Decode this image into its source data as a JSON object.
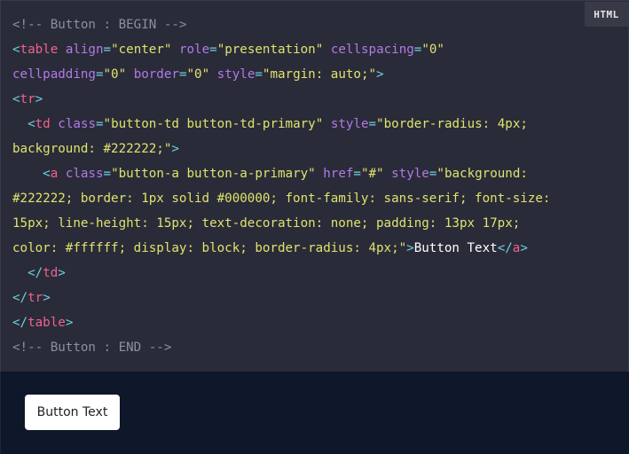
{
  "code_block": {
    "language_label": "HTML",
    "lines": [
      [
        {
          "cls": "c",
          "text": "<!-- Button : BEGIN -->"
        }
      ],
      [
        {
          "cls": "p",
          "text": "<"
        },
        {
          "cls": "t",
          "text": "table"
        },
        {
          "cls": "x",
          "text": " "
        },
        {
          "cls": "a",
          "text": "align"
        },
        {
          "cls": "p",
          "text": "="
        },
        {
          "cls": "s",
          "text": "\"center\""
        },
        {
          "cls": "x",
          "text": " "
        },
        {
          "cls": "a",
          "text": "role"
        },
        {
          "cls": "p",
          "text": "="
        },
        {
          "cls": "s",
          "text": "\"presentation\""
        },
        {
          "cls": "x",
          "text": " "
        },
        {
          "cls": "a",
          "text": "cellspacing"
        },
        {
          "cls": "p",
          "text": "="
        },
        {
          "cls": "s",
          "text": "\"0\""
        }
      ],
      [
        {
          "cls": "a",
          "text": "cellpadding"
        },
        {
          "cls": "p",
          "text": "="
        },
        {
          "cls": "s",
          "text": "\"0\""
        },
        {
          "cls": "x",
          "text": " "
        },
        {
          "cls": "a",
          "text": "border"
        },
        {
          "cls": "p",
          "text": "="
        },
        {
          "cls": "s",
          "text": "\"0\""
        },
        {
          "cls": "x",
          "text": " "
        },
        {
          "cls": "a",
          "text": "style"
        },
        {
          "cls": "p",
          "text": "="
        },
        {
          "cls": "s",
          "text": "\"margin: auto;\""
        },
        {
          "cls": "p",
          "text": ">"
        }
      ],
      [
        {
          "cls": "p",
          "text": "<"
        },
        {
          "cls": "t",
          "text": "tr"
        },
        {
          "cls": "p",
          "text": ">"
        }
      ],
      [
        {
          "cls": "x",
          "text": "  "
        },
        {
          "cls": "p",
          "text": "<"
        },
        {
          "cls": "t",
          "text": "td"
        },
        {
          "cls": "x",
          "text": " "
        },
        {
          "cls": "a",
          "text": "class"
        },
        {
          "cls": "p",
          "text": "="
        },
        {
          "cls": "s",
          "text": "\"button-td button-td-primary\""
        },
        {
          "cls": "x",
          "text": " "
        },
        {
          "cls": "a",
          "text": "style"
        },
        {
          "cls": "p",
          "text": "="
        },
        {
          "cls": "s",
          "text": "\"border-radius: 4px;"
        }
      ],
      [
        {
          "cls": "s",
          "text": "background: #222222;\""
        },
        {
          "cls": "p",
          "text": ">"
        }
      ],
      [
        {
          "cls": "x",
          "text": "    "
        },
        {
          "cls": "p",
          "text": "<"
        },
        {
          "cls": "t",
          "text": "a"
        },
        {
          "cls": "x",
          "text": " "
        },
        {
          "cls": "a",
          "text": "class"
        },
        {
          "cls": "p",
          "text": "="
        },
        {
          "cls": "s",
          "text": "\"button-a button-a-primary\""
        },
        {
          "cls": "x",
          "text": " "
        },
        {
          "cls": "a",
          "text": "href"
        },
        {
          "cls": "p",
          "text": "="
        },
        {
          "cls": "s",
          "text": "\"#\""
        },
        {
          "cls": "x",
          "text": " "
        },
        {
          "cls": "a",
          "text": "style"
        },
        {
          "cls": "p",
          "text": "="
        },
        {
          "cls": "s",
          "text": "\"background:"
        }
      ],
      [
        {
          "cls": "s",
          "text": "#222222; border: 1px solid #000000; font-family: sans-serif; font-size:"
        }
      ],
      [
        {
          "cls": "s",
          "text": "15px; line-height: 15px; text-decoration: none; padding: 13px 17px;"
        }
      ],
      [
        {
          "cls": "s",
          "text": "color: #ffffff; display: block; border-radius: 4px;\""
        },
        {
          "cls": "p",
          "text": ">"
        },
        {
          "cls": "x",
          "text": "Button Text"
        },
        {
          "cls": "p",
          "text": "</"
        },
        {
          "cls": "t",
          "text": "a"
        },
        {
          "cls": "p",
          "text": ">"
        }
      ],
      [
        {
          "cls": "x",
          "text": "  "
        },
        {
          "cls": "p",
          "text": "</"
        },
        {
          "cls": "t",
          "text": "td"
        },
        {
          "cls": "p",
          "text": ">"
        }
      ],
      [
        {
          "cls": "p",
          "text": "</"
        },
        {
          "cls": "t",
          "text": "tr"
        },
        {
          "cls": "p",
          "text": ">"
        }
      ],
      [
        {
          "cls": "p",
          "text": "</"
        },
        {
          "cls": "t",
          "text": "table"
        },
        {
          "cls": "p",
          "text": ">"
        }
      ],
      [
        {
          "cls": "c",
          "text": "<!-- Button : END -->"
        }
      ]
    ]
  },
  "preview": {
    "button_label": "Button Text"
  },
  "colors": {
    "code_background": "#2a2b38",
    "preview_background": "#0f172a",
    "comment": "#8b8fa3",
    "punctuation": "#6ecfe0",
    "tag": "#f0628f",
    "attribute": "#b07ae8",
    "string": "#dfe36e",
    "text": "#ffffff"
  }
}
